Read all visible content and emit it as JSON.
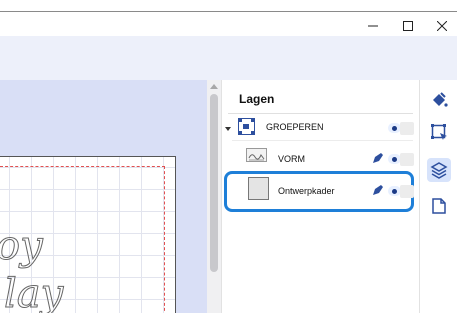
{
  "window": {
    "minimize_glyph": "–",
    "maximize_glyph": "☐",
    "close_glyph": "✕"
  },
  "canvas": {
    "art_line_1": "oy",
    "art_line_2": "lay"
  },
  "layers_panel": {
    "title": "Lagen",
    "layers": [
      {
        "label": "GROEPEREN",
        "type": "group",
        "expanded": true,
        "visible": true
      },
      {
        "label": "VORM",
        "type": "shape",
        "visible": true
      },
      {
        "label": "Ontwerpkader",
        "type": "frame",
        "visible": true,
        "selected": true
      }
    ]
  },
  "toolstrip": {
    "tools": [
      {
        "icon": "paint-bucket-icon",
        "active": false
      },
      {
        "icon": "transform-select-icon",
        "active": false
      },
      {
        "icon": "layers-icon",
        "active": true
      },
      {
        "icon": "page-icon",
        "active": false
      }
    ]
  },
  "colors": {
    "accent": "#1e7fd8",
    "icon_blue": "#2d4f9e",
    "canvas_bg": "#d9dff6",
    "guide_red": "#e05050"
  }
}
